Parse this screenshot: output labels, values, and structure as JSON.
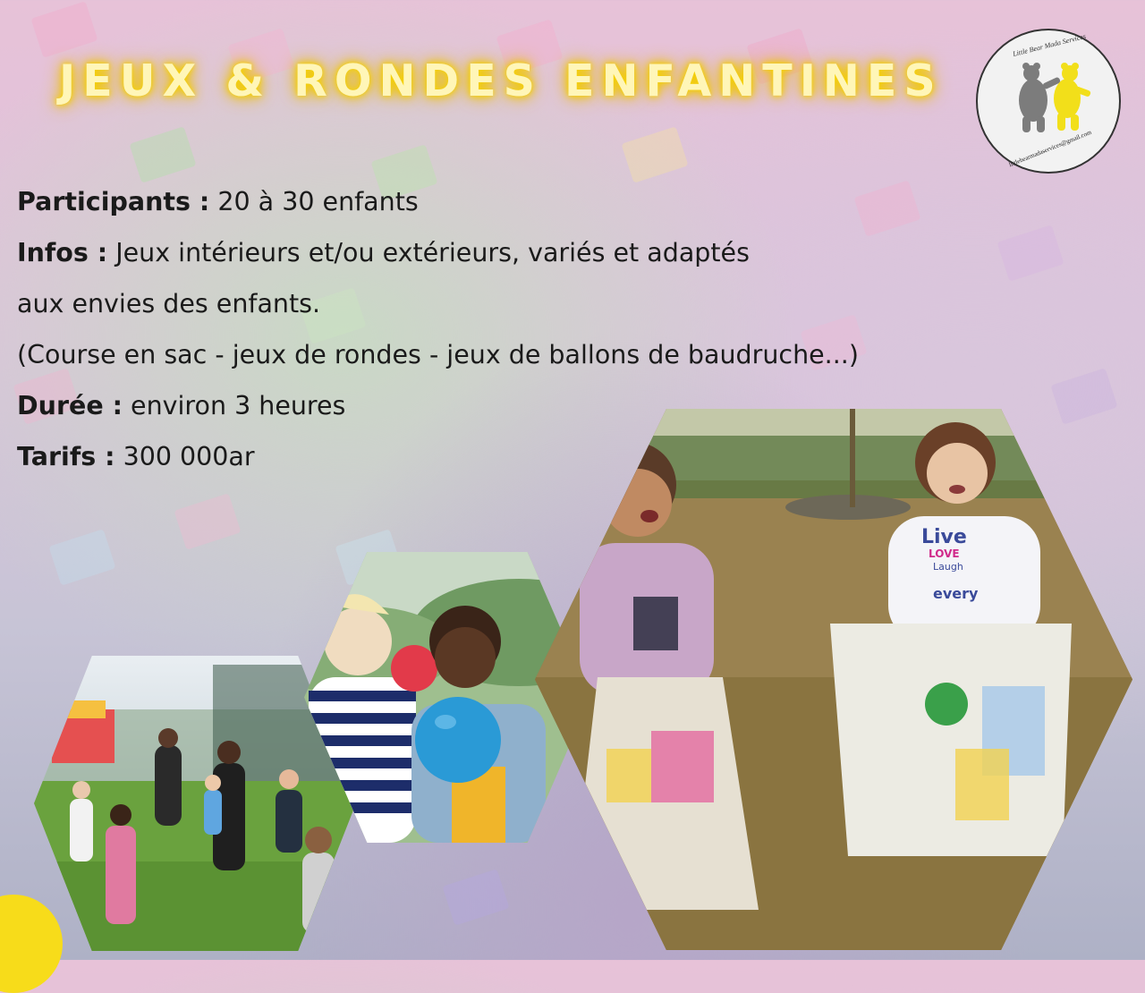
{
  "title": "JEUX & RONDES ENFANTINES",
  "logo": {
    "name": "Little Bear Mada Services",
    "email": "littlebearmadaservices@gmail.com"
  },
  "details": [
    {
      "label": "Participants :",
      "value": "20 à 30 enfants"
    },
    {
      "label": "Infos :",
      "value": "Jeux intérieurs et/ou extérieurs, variés et adaptés"
    },
    {
      "label": "",
      "value": "aux envies des enfants."
    },
    {
      "label": "",
      "value": "(Course en sac - jeux de rondes - jeux de ballons de baudruche...)"
    },
    {
      "label": "Durée :",
      "value": "environ 3 heures"
    },
    {
      "label": "Tarifs :",
      "value": "300 000ar"
    }
  ],
  "photos": {
    "large_tshirt_text": [
      "Live",
      "LOVE",
      "Laugh",
      "every"
    ]
  },
  "colors": {
    "title_glow": "#f7d400",
    "accent_yellow": "#f7dc1a",
    "text": "#1a1a1a"
  }
}
